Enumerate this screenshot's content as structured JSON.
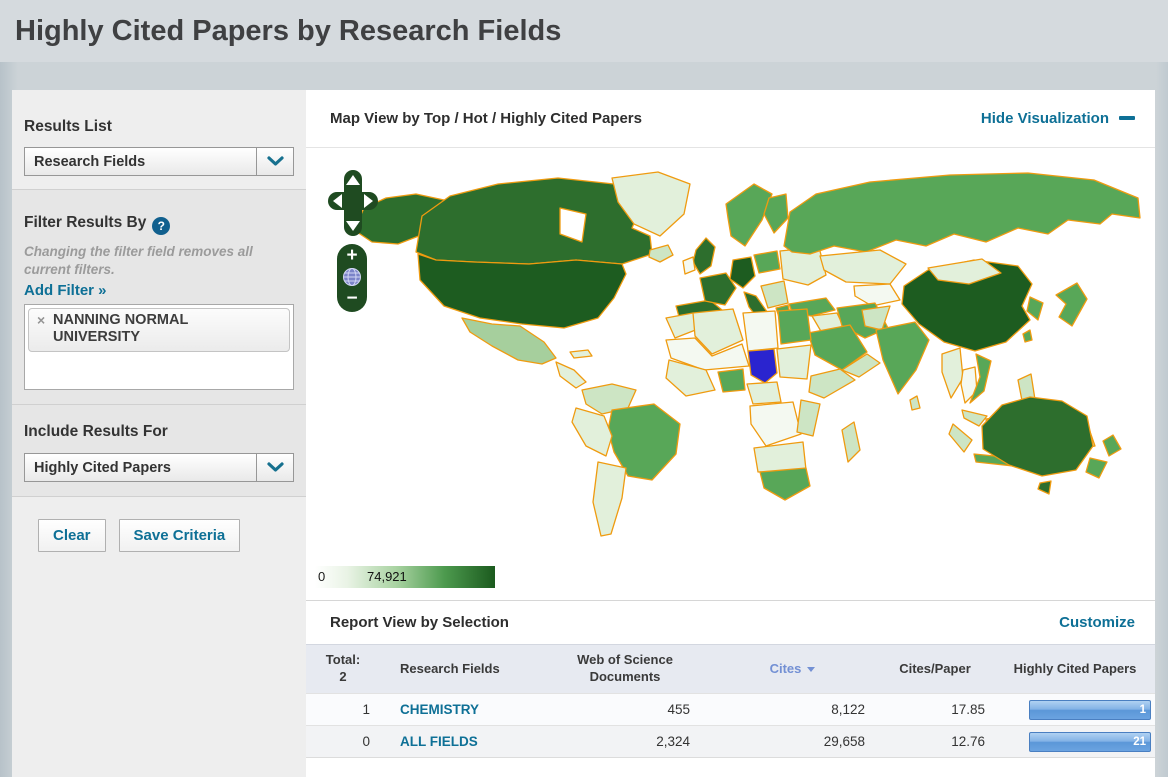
{
  "page": {
    "title": "Highly Cited Papers by Research Fields"
  },
  "sidebar": {
    "results_list": {
      "heading": "Results List",
      "selected": "Research Fields"
    },
    "filter": {
      "heading": "Filter Results By",
      "help": "?",
      "note": "Changing the filter field removes all current filters.",
      "add_filter_label": "Add Filter »",
      "tag": {
        "remove": "×",
        "label": "NANNING NORMAL UNIVERSITY"
      }
    },
    "include": {
      "heading": "Include Results For",
      "selected": "Highly Cited Papers"
    },
    "actions": {
      "clear": "Clear",
      "save": "Save Criteria"
    }
  },
  "map": {
    "heading": "Map View by Top / Hot / Highly Cited Papers",
    "hide_label": "Hide Visualization",
    "legend": {
      "min": "0",
      "max": "74,921"
    },
    "colors": {
      "country_border": "#ef9b10",
      "selected_country": "#2a24cf",
      "scale_low": "#ffffff",
      "scale_high": "#1d5c20",
      "control_green": "#1f4b21"
    },
    "controls": {
      "zoom_in": "+",
      "zoom_out": "−"
    }
  },
  "report": {
    "heading": "Report View by Selection",
    "customize_label": "Customize",
    "table": {
      "total_label": "Total:",
      "total_value": "2",
      "columns": [
        {
          "label": "Research Fields",
          "sorted": false
        },
        {
          "label": "Web of Science Documents",
          "sorted": false
        },
        {
          "label": "Cites",
          "sorted": true
        },
        {
          "label": "Cites/Paper",
          "sorted": false
        },
        {
          "label": "Highly Cited Papers",
          "sorted": false
        }
      ],
      "rows": [
        {
          "count": "1",
          "field": "CHEMISTRY",
          "wos_documents": "455",
          "cites": "8,122",
          "cites_per_paper": "17.85",
          "highly_cited_papers": "1"
        },
        {
          "count": "0",
          "field": "ALL FIELDS",
          "wos_documents": "2,324",
          "cites": "29,658",
          "cites_per_paper": "12.76",
          "highly_cited_papers": "21"
        }
      ]
    }
  }
}
